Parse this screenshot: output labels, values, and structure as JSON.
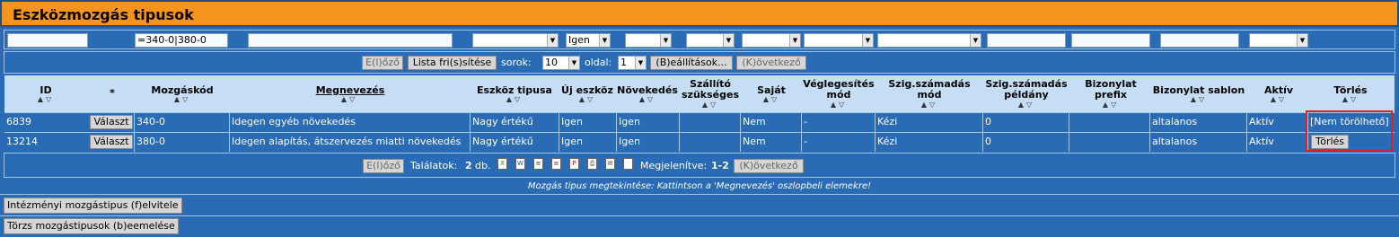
{
  "title": "Eszközmozgás tipusok",
  "filters": {
    "mozgaskod_value": "=340-0|380-0",
    "igen_value": "Igen"
  },
  "pager_top": {
    "prev_label": "E(l)őző",
    "refresh_label": "Lista fri(s)sítése",
    "rows_label": "sorok:",
    "rows_value": "10",
    "page_label": "oldal:",
    "page_value": "1",
    "settings_label": "(B)eállítások...",
    "next_label": "(K)övetkező"
  },
  "columns": {
    "id": "ID",
    "star": "*",
    "mozgaskod": "Mozgáskód",
    "megnevezes": "Megnevezés",
    "eszkoz_tipusa": "Eszköz tipusa",
    "uj_eszkoz": "Új eszköz",
    "novekedes": "Növekedés",
    "szallito_1": "Szállító",
    "szallito_2": "szükséges",
    "sajat": "Saját",
    "veglegesites_1": "Véglegesítés",
    "veglegesites_2": "mód",
    "szigszam_mod_1": "Szig.számadás",
    "szigszam_mod_2": "mód",
    "szigszam_pld_1": "Szig.számadás",
    "szigszam_pld_2": "példány",
    "bizonylat_prefix_1": "Bizonylat",
    "bizonylat_prefix_2": "prefix",
    "bizonylat_sablon": "Bizonylat sablon",
    "aktiv": "Aktív",
    "torles": "Törlés"
  },
  "rows": [
    {
      "id": "6839",
      "select_label": "Választ",
      "mozgaskod": "340-0",
      "megnevezes": "Idegen egyéb növekedés",
      "eszkoz_tipusa": "Nagy értékű",
      "uj_eszkoz": "Igen",
      "novekedes": "Igen",
      "szallito": "",
      "sajat": "Nem",
      "veglegesites": "-",
      "szigszam_mod": "Kézi",
      "szigszam_pld": "0",
      "bizonylat_prefix": "",
      "bizonylat_sablon": "altalanos",
      "aktiv": "Aktív",
      "torles": "[Nem törölhető]"
    },
    {
      "id": "13214",
      "select_label": "Választ",
      "mozgaskod": "380-0",
      "megnevezes": "Idegen alapítás, átszervezés miatti növekedés",
      "eszkoz_tipusa": "Nagy értékű",
      "uj_eszkoz": "Igen",
      "novekedes": "Igen",
      "szallito": "",
      "sajat": "Nem",
      "veglegesites": "-",
      "szigszam_mod": "Kézi",
      "szigszam_pld": "0",
      "bizonylat_prefix": "",
      "bizonylat_sablon": "altalanos",
      "aktiv": "Aktív",
      "torles": "Törlés"
    }
  ],
  "pager_bottom": {
    "prev_label": "E(l)őző",
    "results_label": "Találatok:",
    "results_count": "2",
    "results_unit": "db.",
    "shown_label": "Megjelenítve:",
    "shown_range": "1-2",
    "next_label": "(K)övetkező"
  },
  "hint": "Mozgás tipus megtekintése: Kattintson a 'Megnevezés' oszlopbeli elemekre!",
  "actions": {
    "add_label": "Intézményi mozgástipus (f)elvitele",
    "import_label": "Törzs mozgástipusok (b)eemelése"
  },
  "icons": [
    "excel-icon",
    "word-icon",
    "doc-icon",
    "text-icon",
    "pdf-icon",
    "print-icon",
    "mail-icon",
    "page-icon"
  ],
  "colors": {
    "title_bar": "#f7941d",
    "panel": "#2a6bb5",
    "header": "#c6def5",
    "highlight": "#d9202c"
  }
}
